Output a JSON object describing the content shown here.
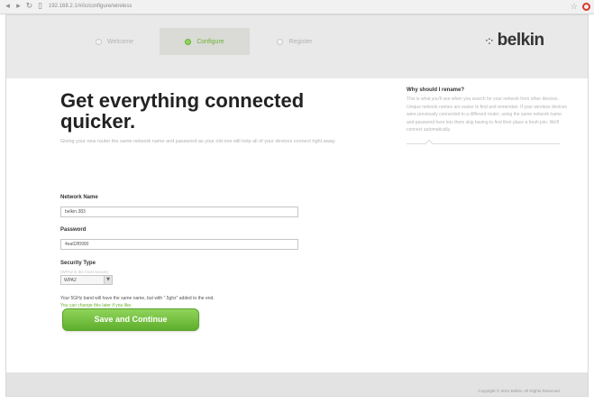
{
  "browser": {
    "back_glyph": "◂",
    "forward_glyph": "▸",
    "reload_glyph": "↻",
    "doc_glyph": "▯",
    "url": "192.168.2.1/#/ic/configure/wireless",
    "star_glyph": "☆"
  },
  "steps": [
    {
      "label": "Welcome"
    },
    {
      "label": "Configure"
    },
    {
      "label": "Register"
    }
  ],
  "logo": {
    "mark": "·:·",
    "text": "belkin"
  },
  "main": {
    "title": "Get everything connected quicker.",
    "intro": "Giving your new router the same network name and password as your old one will help all of your devices connect right away."
  },
  "form": {
    "network_name_label": "Network Name",
    "network_name_value": "belkin.383",
    "password_label": "Password",
    "password_value": "4ea02f0990",
    "security_label": "Security Type",
    "security_sub": "(WPA2 is the most secure)",
    "security_value": "WPA2",
    "note": "Your 5GHz band will have the same name, but with \".5ghz\" added to the end.",
    "note_link": "You can change this later if you like.",
    "save_label": "Save and Continue"
  },
  "sidebar": {
    "title": "Why should I rename?",
    "body": "This is what you'll see when you search for your network from other devices. Unique network names are easier to find and remember. If your wireless devices were previously connected to a different router, using the same network name and password here lets them skip having to find their place a fresh join. We'll connect automatically."
  },
  "footer": {
    "copyright": "Copyright © 2012 Belkin. All Rights Reserved."
  },
  "colors": {
    "accent_green": "#6bb236",
    "button_green": "#7cc447"
  }
}
